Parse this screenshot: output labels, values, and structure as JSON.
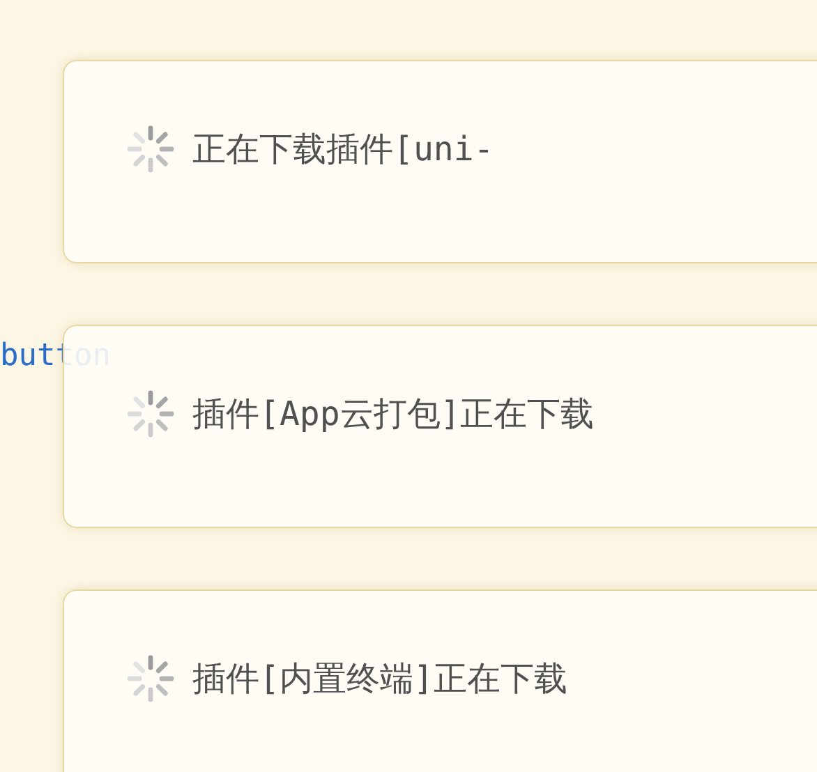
{
  "editor": {
    "code_text": "button"
  },
  "notifications": [
    {
      "message": "正在下载插件[uni-",
      "loading": true
    },
    {
      "message": "插件[App云打包]正在下载",
      "loading": true
    },
    {
      "message": "插件[内置终端]正在下载",
      "loading": true
    }
  ]
}
